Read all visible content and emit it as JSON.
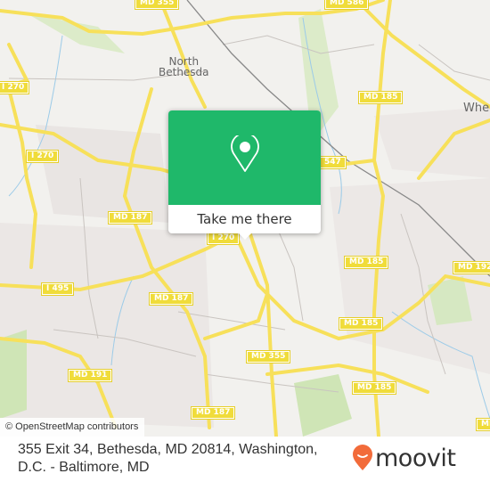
{
  "map": {
    "place_labels": [
      {
        "id": "north-bethesda",
        "text": "North\nBethesda"
      },
      {
        "id": "wheaton",
        "text": "Whea"
      }
    ],
    "road_shields": [
      {
        "id": "md355-top",
        "text": "MD 355"
      },
      {
        "id": "md586-top",
        "text": "MD 586"
      },
      {
        "id": "i270-left",
        "text": "I 270"
      },
      {
        "id": "md185-north",
        "text": "MD 185"
      },
      {
        "id": "i270-mid",
        "text": "I 270"
      },
      {
        "id": "547",
        "text": "547"
      },
      {
        "id": "md187-upper",
        "text": "MD 187"
      },
      {
        "id": "i270-center",
        "text": "I 270"
      },
      {
        "id": "md185-center",
        "text": "MD 185"
      },
      {
        "id": "md192",
        "text": "MD 192"
      },
      {
        "id": "i495",
        "text": "I 495"
      },
      {
        "id": "md187-lower",
        "text": "MD 187"
      },
      {
        "id": "md185-south",
        "text": "MD 185"
      },
      {
        "id": "md355-south",
        "text": "MD 355"
      },
      {
        "id": "md191",
        "text": "MD 191"
      },
      {
        "id": "md185-bottom",
        "text": "MD 185"
      },
      {
        "id": "md187-bottom",
        "text": "MD 187"
      },
      {
        "id": "md-bottom-right",
        "text": "MD"
      }
    ],
    "attribution": "© OpenStreetMap contributors",
    "colors": {
      "land": "#f2f1ee",
      "road": "#f7e05a",
      "park": "#cde5b4",
      "water": "#9ccbe8",
      "popup_green": "#1fb86a"
    }
  },
  "popup": {
    "icon": "map-pin-icon",
    "cta_label": "Take me there"
  },
  "footer": {
    "address": "355 Exit 34, Bethesda, MD 20814, Washington, D.C. - Baltimore, MD",
    "brand": "moovit",
    "brand_color": "#f26b3a"
  }
}
